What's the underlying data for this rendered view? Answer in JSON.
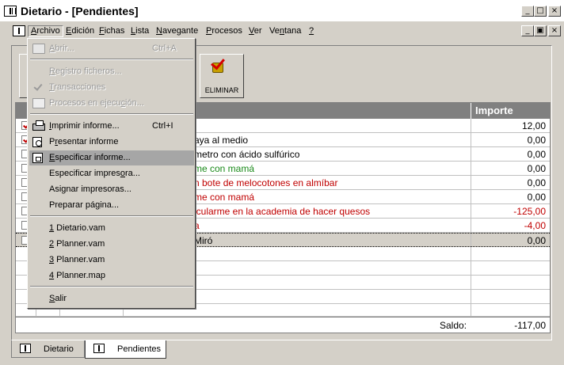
{
  "window": {
    "title": "Dietario - [Pendientes]",
    "min_glyph": "_",
    "max_glyph": "□",
    "close_glyph": "×",
    "child_restore_glyph": "▣"
  },
  "menubar": {
    "items": [
      {
        "label": "Archivo",
        "ul": "A",
        "rest": "rchivo"
      },
      {
        "label": "Edición",
        "ul": "E",
        "rest": "dición"
      },
      {
        "label": "Fichas",
        "ul": "F",
        "rest": "ichas"
      },
      {
        "label": "Lista",
        "ul": "L",
        "rest": "ista"
      },
      {
        "label": "Navegante",
        "ul": "N",
        "rest": "avegante"
      },
      {
        "label": "Procesos",
        "ul": "P",
        "rest": "rocesos"
      },
      {
        "label": "Ver",
        "ul": "V",
        "rest": "er"
      },
      {
        "label": "Ventana",
        "pre": "Ve",
        "ul": "n",
        "rest": "tana"
      },
      {
        "label": "?",
        "ul": "?",
        "rest": ""
      }
    ]
  },
  "toolbar": {
    "eliminar_label": "ELIMINAR"
  },
  "grid": {
    "header_importe": "Importe",
    "rows": [
      {
        "checked": true,
        "desc": "",
        "amount": "12,00",
        "desc_color": "#000000",
        "amount_color": "#000000"
      },
      {
        "checked": true,
        "desc": "aya al medio",
        "amount": "0,00",
        "desc_color": "#000000",
        "amount_color": "#000000"
      },
      {
        "checked": false,
        "desc": "metro con ácido sulfúrico",
        "amount": "0,00",
        "desc_color": "#000000",
        "amount_color": "#000000"
      },
      {
        "checked": false,
        "desc": "me con mamá",
        "amount": "0,00",
        "desc_color": "#1a8a1a",
        "amount_color": "#000000"
      },
      {
        "checked": false,
        "desc": "n bote de melocotones en almíbar",
        "amount": "0,00",
        "desc_color": "#c00000",
        "amount_color": "#000000"
      },
      {
        "checked": false,
        "desc": "me con mamá",
        "amount": "0,00",
        "desc_color": "#c00000",
        "amount_color": "#000000"
      },
      {
        "checked": false,
        "desc": "icularme en la academia de hacer quesos",
        "amount": "-125,00",
        "desc_color": "#c00000",
        "amount_color": "#c00000"
      },
      {
        "checked": false,
        "desc": "a",
        "amount": "-4,00",
        "desc_color": "#c00000",
        "amount_color": "#c00000"
      },
      {
        "checked": false,
        "desc": "Miró",
        "amount": "0,00",
        "desc_color": "#000000",
        "amount_color": "#000000"
      }
    ],
    "saldo_label": "Saldo:",
    "saldo_value": "-117,00"
  },
  "tabs": [
    {
      "label": "Dietario"
    },
    {
      "label": "Pendientes"
    }
  ],
  "file_menu": {
    "abrir": {
      "ul": "A",
      "rest": "brir...",
      "shortcut": "Ctrl+A"
    },
    "registro": {
      "ul": "R",
      "rest": "egistro ficheros..."
    },
    "transacciones": {
      "ul": "T",
      "rest": "ransacciones"
    },
    "procesos": {
      "pre": "Procesos en ejecu",
      "ul": "c",
      "rest": "ión..."
    },
    "imprimir": {
      "ul": "I",
      "rest": "mprimir informe...",
      "shortcut": "Ctrl+I"
    },
    "presentar": {
      "pre": "P",
      "ul": "r",
      "rest": "esentar informe"
    },
    "especificar": {
      "ul": "E",
      "rest": "specificar informe..."
    },
    "esp_impresora": {
      "pre": "Especificar impres",
      "ul": "o",
      "rest": "ra..."
    },
    "asignar": {
      "pre": "Asi",
      "ul": "g",
      "rest": "nar impresoras..."
    },
    "preparar": {
      "pre": "Preparar pá",
      "ul": "g",
      "rest": "ina..."
    },
    "recent": [
      {
        "ul": "1",
        "rest": " Dietario.vam"
      },
      {
        "ul": "2",
        "rest": " Planner.vam"
      },
      {
        "ul": "3",
        "rest": " Planner.vam"
      },
      {
        "ul": "4",
        "rest": " Planner.map"
      }
    ],
    "salir": {
      "ul": "S",
      "rest": "alir"
    }
  }
}
